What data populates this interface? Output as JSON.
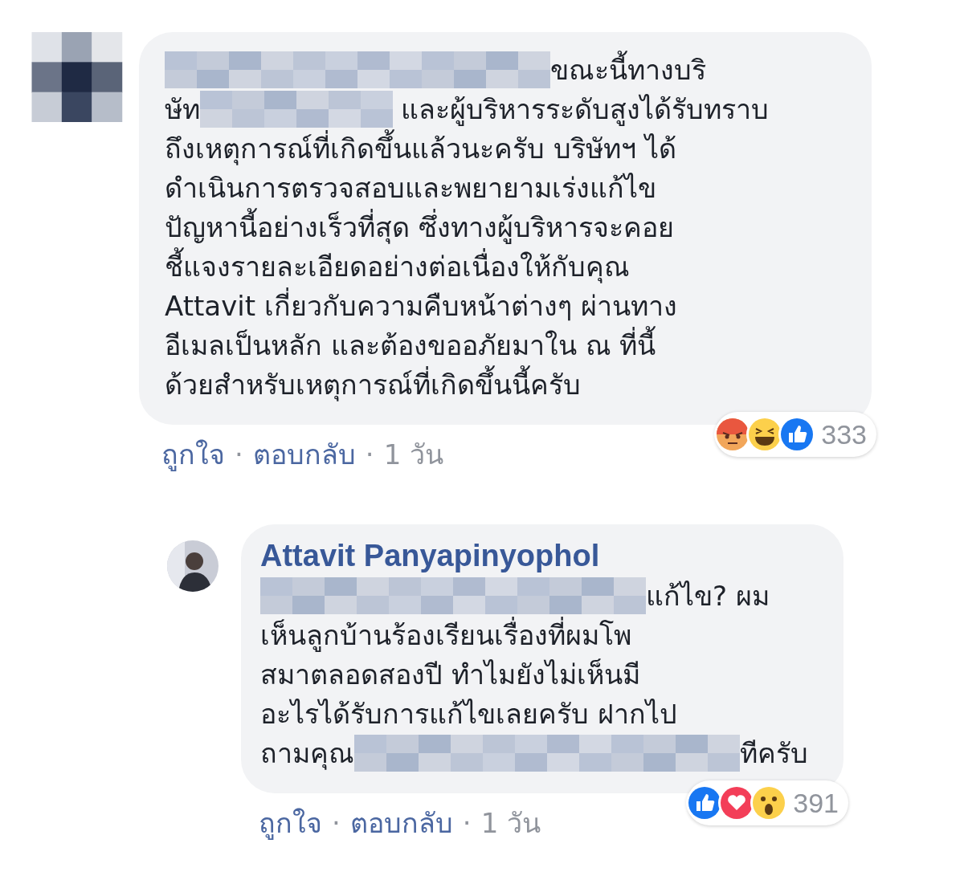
{
  "comments": [
    {
      "avatar": {
        "kind": "pixelated"
      },
      "lines": [
        [
          {
            "kind": "redacted_wide"
          },
          {
            "kind": "text",
            "text": "ขณะนี้ทางบริ"
          }
        ],
        [
          {
            "kind": "text",
            "text": "ษัท"
          },
          {
            "kind": "redacted_medium"
          },
          {
            "kind": "text",
            "text": "และผู้บริหารระดับสูงได้รับทราบ"
          }
        ],
        [
          {
            "kind": "text",
            "text": "ถึงเหตุการณ์ที่เกิดขึ้นแล้วนะครับ บริษัทฯ ได้"
          }
        ],
        [
          {
            "kind": "text",
            "text": "ดำเนินการตรวจสอบและพยายามเร่งแก้ไข"
          }
        ],
        [
          {
            "kind": "text",
            "text": "ปัญหานี้อย่างเร็วที่สุด ซึ่งทางผู้บริหารจะคอย"
          }
        ],
        [
          {
            "kind": "text",
            "text": "ชี้แจงรายละเอียดอย่างต่อเนื่องให้กับคุณ"
          }
        ],
        [
          {
            "kind": "text",
            "text": "Attavit เกี่ยวกับความคืบหน้าต่างๆ ผ่านทาง"
          }
        ],
        [
          {
            "kind": "text",
            "text": "อีเมลเป็นหลัก และต้องขออภัยมาใน ณ ที่นี้"
          }
        ],
        [
          {
            "kind": "text",
            "text": "ด้วยสำหรับเหตุการณ์ที่เกิดขึ้นนี้ครับ"
          }
        ]
      ],
      "reactions": [
        {
          "kind": "angry"
        },
        {
          "kind": "haha"
        },
        {
          "kind": "like"
        }
      ],
      "reaction_count": "333",
      "actions": {
        "like": "ถูกใจ",
        "separator_1": "·",
        "reply": "ตอบกลับ",
        "separator_2": "·",
        "time": "1 วัน"
      }
    },
    {
      "avatar": {
        "kind": "photo"
      },
      "author": "Attavit Panyapinyophol",
      "lines": [
        [
          {
            "kind": "redacted_wide"
          },
          {
            "kind": "text",
            "text": "แก้ไข? ผม"
          }
        ],
        [
          {
            "kind": "text",
            "text": "เห็นลูกบ้านร้องเรียนเรื่องที่ผมโพ"
          }
        ],
        [
          {
            "kind": "text",
            "text": "สมาตลอดสองปี ทำไมยังไม่เห็นมี"
          }
        ],
        [
          {
            "kind": "text",
            "text": "อะไรได้รับการแก้ไขเลยครับ ฝากไป"
          }
        ],
        [
          {
            "kind": "text",
            "text": "ถามคุณ"
          },
          {
            "kind": "redacted_wide"
          },
          {
            "kind": "text",
            "text": "ทีครับ"
          }
        ]
      ],
      "reactions": [
        {
          "kind": "like"
        },
        {
          "kind": "love"
        },
        {
          "kind": "wow"
        }
      ],
      "reaction_count": "391",
      "actions": {
        "like": "ถูกใจ",
        "separator_1": "·",
        "reply": "ตอบกลับ",
        "separator_2": "·",
        "time": "1 วัน"
      }
    }
  ]
}
